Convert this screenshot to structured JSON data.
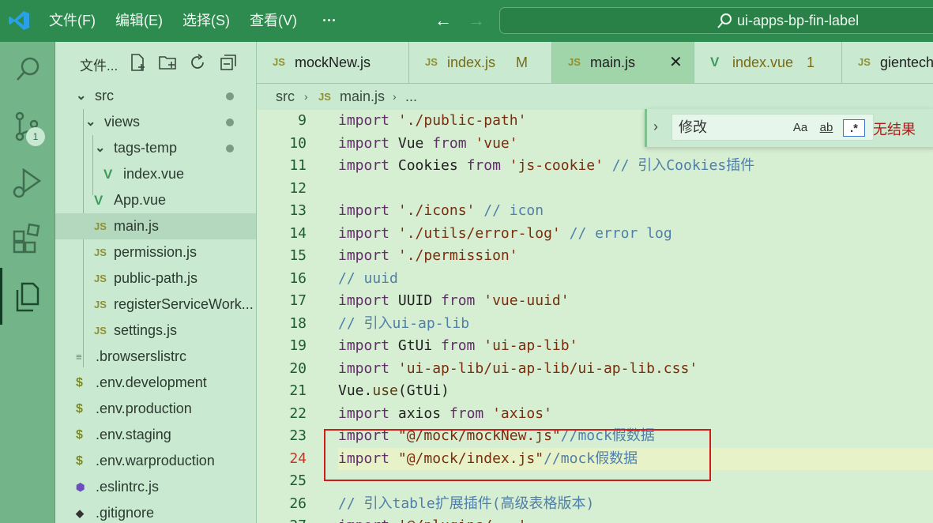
{
  "titlebar": {
    "menus": [
      "文件(F)",
      "编辑(E)",
      "选择(S)",
      "查看(V)",
      "···"
    ],
    "search_text": "ui-apps-bp-fin-label",
    "search_icon": "search-icon"
  },
  "activity": {
    "scm_badge": "1"
  },
  "explorer": {
    "title": "文件...",
    "items": [
      {
        "label": "src",
        "type": "folder",
        "indent": 0,
        "expanded": true,
        "dot": true
      },
      {
        "label": "views",
        "type": "folder",
        "indent": 1,
        "expanded": true,
        "dot": true
      },
      {
        "label": "tags-temp",
        "type": "folder",
        "indent": 2,
        "expanded": true,
        "dot": true
      },
      {
        "label": "index.vue",
        "type": "vue",
        "indent": 2
      },
      {
        "label": "App.vue",
        "type": "vue",
        "indent": 1
      },
      {
        "label": "main.js",
        "type": "js",
        "indent": 1,
        "selected": true
      },
      {
        "label": "permission.js",
        "type": "js",
        "indent": 1
      },
      {
        "label": "public-path.js",
        "type": "js",
        "indent": 1
      },
      {
        "label": "registerServiceWork...",
        "type": "js",
        "indent": 1
      },
      {
        "label": "settings.js",
        "type": "js",
        "indent": 1
      },
      {
        "label": ".browserslistrc",
        "type": "text",
        "indent": 0
      },
      {
        "label": ".env.development",
        "type": "env",
        "indent": 0
      },
      {
        "label": ".env.production",
        "type": "env",
        "indent": 0
      },
      {
        "label": ".env.staging",
        "type": "env",
        "indent": 0
      },
      {
        "label": ".env.warproduction",
        "type": "env",
        "indent": 0
      },
      {
        "label": ".eslintrc.js",
        "type": "eslint",
        "indent": 0
      },
      {
        "label": ".gitignore",
        "type": "git",
        "indent": 0
      }
    ]
  },
  "tabs": [
    {
      "icon": "JS",
      "label": "mockNew.js",
      "suffix": ""
    },
    {
      "icon": "JS",
      "label": "index.js",
      "suffix": "M"
    },
    {
      "icon": "JS",
      "label": "main.js",
      "suffix": "",
      "active": true
    },
    {
      "icon": "V",
      "label": "index.vue",
      "suffix": "1"
    },
    {
      "icon": "JS",
      "label": "gientech",
      "suffix": ""
    }
  ],
  "breadcrumb": {
    "folder": "src",
    "icon": "JS",
    "file": "main.js",
    "tail": "..."
  },
  "find": {
    "placeholder": "修改",
    "case_label": "Aa",
    "word_label": "ab",
    "regex_label": ".*",
    "result": "无结果"
  },
  "code": [
    {
      "n": "9",
      "t": [
        [
          "kw",
          "import "
        ],
        [
          "str",
          "'./public-path'"
        ]
      ]
    },
    {
      "n": "10",
      "t": [
        [
          "kw",
          "import "
        ],
        [
          "",
          "Vue "
        ],
        [
          "kw",
          "from "
        ],
        [
          "str",
          "'vue'"
        ]
      ]
    },
    {
      "n": "11",
      "t": [
        [
          "kw",
          "import "
        ],
        [
          "",
          "Cookies "
        ],
        [
          "kw",
          "from "
        ],
        [
          "str",
          "'js-cookie' "
        ],
        [
          "cm",
          "// 引入Cookies插件"
        ]
      ]
    },
    {
      "n": "12",
      "t": []
    },
    {
      "n": "13",
      "t": [
        [
          "kw",
          "import "
        ],
        [
          "str",
          "'./icons' "
        ],
        [
          "cm",
          "// icon"
        ]
      ]
    },
    {
      "n": "14",
      "t": [
        [
          "kw",
          "import "
        ],
        [
          "str",
          "'./utils/error-log' "
        ],
        [
          "cm",
          "// error log"
        ]
      ]
    },
    {
      "n": "15",
      "t": [
        [
          "kw",
          "import "
        ],
        [
          "str",
          "'./permission'"
        ]
      ]
    },
    {
      "n": "16",
      "t": [
        [
          "cm",
          "// uuid"
        ]
      ]
    },
    {
      "n": "17",
      "t": [
        [
          "kw",
          "import "
        ],
        [
          "",
          "UUID "
        ],
        [
          "kw",
          "from "
        ],
        [
          "str",
          "'vue-uuid'"
        ]
      ]
    },
    {
      "n": "18",
      "t": [
        [
          "cm",
          "// 引入ui-ap-lib"
        ]
      ]
    },
    {
      "n": "19",
      "t": [
        [
          "kw",
          "import "
        ],
        [
          "",
          "GtUi "
        ],
        [
          "kw",
          "from "
        ],
        [
          "str",
          "'ui-ap-lib'"
        ]
      ]
    },
    {
      "n": "20",
      "t": [
        [
          "kw",
          "import "
        ],
        [
          "str",
          "'ui-ap-lib/ui-ap-lib/ui-ap-lib.css'"
        ]
      ]
    },
    {
      "n": "21",
      "t": [
        [
          "",
          "Vue."
        ],
        [
          "fn",
          "use"
        ],
        [
          "",
          "(GtUi)"
        ]
      ]
    },
    {
      "n": "22",
      "t": [
        [
          "kw",
          "import "
        ],
        [
          "",
          "axios "
        ],
        [
          "kw",
          "from "
        ],
        [
          "str",
          "'axios'"
        ]
      ]
    },
    {
      "n": "23",
      "t": [
        [
          "kw",
          "import "
        ],
        [
          "str",
          "\"@/mock/mockNew.js\""
        ],
        [
          "cm",
          "//mock假数据"
        ]
      ]
    },
    {
      "n": "24",
      "t": [
        [
          "kw",
          "import "
        ],
        [
          "str",
          "\"@/mock/index.js\""
        ],
        [
          "cm",
          "//mock假数据"
        ]
      ],
      "current": true
    },
    {
      "n": "25",
      "t": []
    },
    {
      "n": "26",
      "t": [
        [
          "cm",
          "// 引入table扩展插件(高级表格版本)"
        ]
      ]
    },
    {
      "n": "27",
      "t": [
        [
          "kw",
          "import "
        ],
        [
          "str",
          "'@/plugins/...'"
        ]
      ]
    }
  ],
  "colors": {
    "accent": "#2e8b4f",
    "highlight_box": "#d11a1a",
    "current_line_no": "#c0392b"
  }
}
